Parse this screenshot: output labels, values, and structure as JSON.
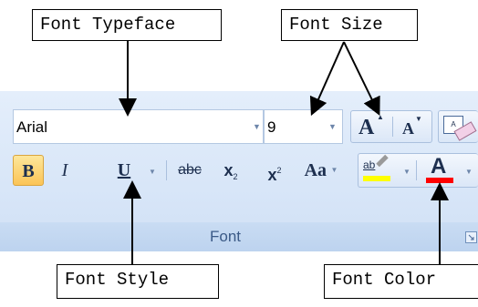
{
  "callouts": {
    "typeface": "Font Typeface",
    "size": "Font Size",
    "style": "Font Style",
    "color": "Font Color"
  },
  "ribbon": {
    "font_name": "Arial",
    "font_size": "9",
    "group_label": "Font",
    "buttons": {
      "bold": "B",
      "italic": "I",
      "underline": "U",
      "strikethrough": "abc",
      "subscript": "x",
      "subscript_mark": "2",
      "superscript": "x",
      "superscript_mark": "2",
      "change_case": "Aa",
      "highlight": "ab",
      "font_color": "A",
      "grow_font": "A",
      "shrink_font": "A",
      "clear_formatting": "A"
    }
  },
  "colors": {
    "highlight": "#ffff00",
    "font_color": "#ff0000",
    "bold_active": "#fcc456"
  },
  "icons": [
    "chevron-down-icon",
    "clear-formatting-icon",
    "dialog-launcher-icon",
    "arrow-icon"
  ]
}
